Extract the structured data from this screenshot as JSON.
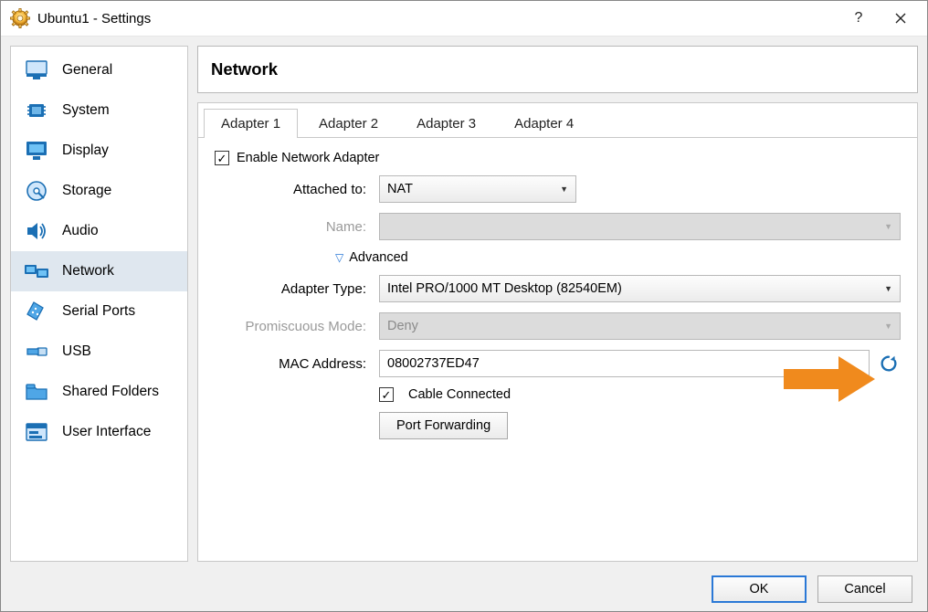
{
  "window": {
    "title": "Ubuntu1 - Settings"
  },
  "sidebar": {
    "items": [
      {
        "label": "General"
      },
      {
        "label": "System"
      },
      {
        "label": "Display"
      },
      {
        "label": "Storage"
      },
      {
        "label": "Audio"
      },
      {
        "label": "Network",
        "active": true
      },
      {
        "label": "Serial Ports"
      },
      {
        "label": "USB"
      },
      {
        "label": "Shared Folders"
      },
      {
        "label": "User Interface"
      }
    ]
  },
  "header": {
    "title": "Network"
  },
  "tabs": [
    "Adapter 1",
    "Adapter 2",
    "Adapter 3",
    "Adapter 4"
  ],
  "active_tab": 0,
  "form": {
    "enable_label": "Enable Network Adapter",
    "enable_checked": true,
    "attached_to_label": "Attached to:",
    "attached_to_value": "NAT",
    "name_label": "Name:",
    "name_value": "",
    "advanced_label": "Advanced",
    "adapter_type_label": "Adapter Type:",
    "adapter_type_value": "Intel PRO/1000 MT Desktop (82540EM)",
    "promiscuous_label": "Promiscuous Mode:",
    "promiscuous_value": "Deny",
    "mac_label": "MAC Address:",
    "mac_value": "08002737ED47",
    "cable_label": "Cable Connected",
    "cable_checked": true,
    "port_forwarding_label": "Port Forwarding"
  },
  "footer": {
    "ok_label": "OK",
    "cancel_label": "Cancel"
  }
}
